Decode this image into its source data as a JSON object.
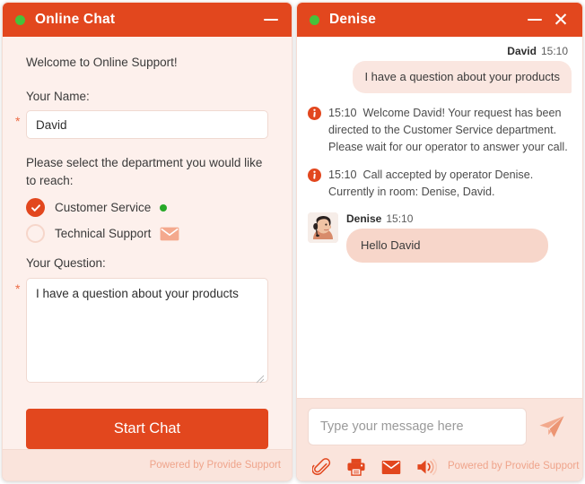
{
  "left_panel": {
    "header": {
      "title": "Online Chat",
      "status_dot_color": "#46C23B",
      "minimize_label": "Minimize"
    },
    "welcome": "Welcome to Online Support!",
    "name_field": {
      "label": "Your Name:",
      "value": "David",
      "placeholder": "",
      "required_marker": "*"
    },
    "department": {
      "prompt": "Please select the department you would like to reach:",
      "options": [
        {
          "label": "Customer Service",
          "selected": true,
          "indicator": "online-dot"
        },
        {
          "label": "Technical Support",
          "selected": false,
          "indicator": "envelope-icon"
        }
      ]
    },
    "question_field": {
      "label": "Your Question:",
      "value": "I have a question about your products",
      "placeholder": "",
      "required_marker": "*"
    },
    "start_button": "Start Chat",
    "footer": "Powered by Provide Support"
  },
  "right_panel": {
    "header": {
      "title": "Denise",
      "status_dot_color": "#46C23B",
      "minimize_label": "Minimize",
      "close_label": "✕"
    },
    "messages": [
      {
        "kind": "user",
        "author": "David",
        "time": "15:10",
        "text": "I have a question about your products"
      },
      {
        "kind": "system",
        "time": "15:10",
        "text": "Welcome David! Your request has been directed to the Customer Service department. Please wait for our operator to answer your call."
      },
      {
        "kind": "system",
        "time": "15:10",
        "text": "Call accepted by operator Denise. Currently in room: Denise, David."
      },
      {
        "kind": "operator",
        "author": "Denise",
        "time": "15:10",
        "text": "Hello David"
      }
    ],
    "compose": {
      "placeholder": "Type your message here",
      "value": "",
      "send_label": "Send"
    },
    "tools": [
      {
        "name": "attach-file",
        "icon": "paperclip-icon"
      },
      {
        "name": "print-transcript",
        "icon": "printer-icon"
      },
      {
        "name": "email-transcript",
        "icon": "envelope-icon"
      },
      {
        "name": "sound-toggle",
        "icon": "speaker-icon"
      }
    ],
    "footer": "Powered by Provide Support"
  },
  "colors": {
    "brand_orange": "#E2471E",
    "panel_tint": "#FDF0EC",
    "footer_tint": "#FAE4DC",
    "bubble_user": "#FAE6E0",
    "bubble_operator": "#F7D6CA",
    "online_green": "#27A828",
    "muted_salmon": "#EFA48B"
  }
}
